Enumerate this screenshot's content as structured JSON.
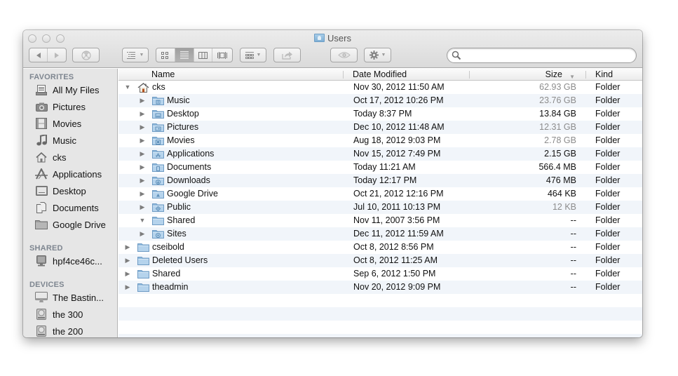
{
  "window": {
    "title": "Users",
    "title_icon": "users-folder-icon"
  },
  "toolbar": {
    "back_icon": "back-arrow-icon",
    "forward_icon": "forward-arrow-icon",
    "burn_icon": "burn-icon",
    "arrange_icon": "arrange-list-icon",
    "view_modes": [
      {
        "name": "icon-view",
        "glyph": "▫▫",
        "active": false
      },
      {
        "name": "list-view",
        "glyph": "≡",
        "active": true
      },
      {
        "name": "column-view",
        "glyph": "▥",
        "active": false
      },
      {
        "name": "cover-flow-view",
        "glyph": "|▬|",
        "active": false
      }
    ],
    "group_icon": "group-by-icon",
    "share_icon": "share-icon",
    "quicklook_icon": "eye-icon",
    "action_icon": "gear-icon",
    "search_placeholder": "",
    "search_value": ""
  },
  "sidebar": {
    "sections": [
      {
        "label": "FAVORITES",
        "items": [
          {
            "label": "All My Files",
            "icon": "all-files-icon"
          },
          {
            "label": "Pictures",
            "icon": "camera-icon"
          },
          {
            "label": "Movies",
            "icon": "film-icon"
          },
          {
            "label": "Music",
            "icon": "music-note-icon"
          },
          {
            "label": "cks",
            "icon": "home-icon"
          },
          {
            "label": "Applications",
            "icon": "applications-icon"
          },
          {
            "label": "Desktop",
            "icon": "desktop-icon"
          },
          {
            "label": "Documents",
            "icon": "documents-icon"
          },
          {
            "label": "Google Drive",
            "icon": "folder-icon"
          }
        ]
      },
      {
        "label": "SHARED",
        "items": [
          {
            "label": "hpf4ce46c...",
            "icon": "network-computer-icon"
          }
        ]
      },
      {
        "label": "DEVICES",
        "items": [
          {
            "label": "The Bastin...",
            "icon": "imac-icon"
          },
          {
            "label": "the 300",
            "icon": "hard-disk-icon"
          },
          {
            "label": "the 200",
            "icon": "hard-disk-icon"
          }
        ]
      }
    ]
  },
  "list": {
    "columns": {
      "name": "Name",
      "date": "Date Modified",
      "size": "Size",
      "kind": "Kind",
      "sort_column": "size",
      "sort_direction": "descending"
    },
    "rows": [
      {
        "name": "cks",
        "level": 0,
        "expanded": true,
        "icon": "home",
        "date": "Nov 30, 2012 11:50 AM",
        "size": "62.93 GB",
        "size_dim": true,
        "kind": "Folder"
      },
      {
        "name": "Music",
        "level": 1,
        "expanded": false,
        "icon": "music",
        "date": "Oct 17, 2012 10:26 PM",
        "size": "23.76 GB",
        "size_dim": true,
        "kind": "Folder"
      },
      {
        "name": "Desktop",
        "level": 1,
        "expanded": false,
        "icon": "desktop",
        "date": "Today 8:37 PM",
        "size": "13.84 GB",
        "size_dim": false,
        "kind": "Folder"
      },
      {
        "name": "Pictures",
        "level": 1,
        "expanded": false,
        "icon": "pictures",
        "date": "Dec 10, 2012 11:48 AM",
        "size": "12.31 GB",
        "size_dim": true,
        "kind": "Folder"
      },
      {
        "name": "Movies",
        "level": 1,
        "expanded": false,
        "icon": "movies",
        "date": "Aug 18, 2012 9:03 PM",
        "size": "2.78 GB",
        "size_dim": true,
        "kind": "Folder"
      },
      {
        "name": "Applications",
        "level": 1,
        "expanded": false,
        "icon": "applications",
        "date": "Nov 15, 2012 7:49 PM",
        "size": "2.15 GB",
        "size_dim": false,
        "kind": "Folder"
      },
      {
        "name": "Documents",
        "level": 1,
        "expanded": false,
        "icon": "documents",
        "date": "Today 11:21 AM",
        "size": "566.4 MB",
        "size_dim": false,
        "kind": "Folder"
      },
      {
        "name": "Downloads",
        "level": 1,
        "expanded": false,
        "icon": "downloads",
        "date": "Today 12:17 PM",
        "size": "476 MB",
        "size_dim": false,
        "kind": "Folder"
      },
      {
        "name": "Google Drive",
        "level": 1,
        "expanded": false,
        "icon": "google-drive",
        "date": "Oct 21, 2012 12:16 PM",
        "size": "464 KB",
        "size_dim": false,
        "kind": "Folder"
      },
      {
        "name": "Public",
        "level": 1,
        "expanded": false,
        "icon": "public",
        "date": "Jul 10, 2011 10:13 PM",
        "size": "12 KB",
        "size_dim": true,
        "kind": "Folder"
      },
      {
        "name": "Shared",
        "level": 1,
        "expanded": true,
        "icon": "plain",
        "date": "Nov 11, 2007 3:56 PM",
        "size": "--",
        "size_dim": false,
        "kind": "Folder"
      },
      {
        "name": "Sites",
        "level": 1,
        "expanded": false,
        "icon": "sites",
        "date": "Dec 11, 2012 11:59 AM",
        "size": "--",
        "size_dim": false,
        "kind": "Folder"
      },
      {
        "name": "cseibold",
        "level": 0,
        "expanded": false,
        "icon": "plain",
        "date": "Oct 8, 2012 8:56 PM",
        "size": "--",
        "size_dim": false,
        "kind": "Folder"
      },
      {
        "name": "Deleted Users",
        "level": 0,
        "expanded": false,
        "icon": "plain",
        "date": "Oct 8, 2012 11:25 AM",
        "size": "--",
        "size_dim": false,
        "kind": "Folder"
      },
      {
        "name": "Shared",
        "level": 0,
        "expanded": false,
        "icon": "plain",
        "date": "Sep 6, 2012 1:50 PM",
        "size": "--",
        "size_dim": false,
        "kind": "Folder"
      },
      {
        "name": "theadmin",
        "level": 0,
        "expanded": false,
        "icon": "plain",
        "date": "Nov 20, 2012 9:09 PM",
        "size": "--",
        "size_dim": false,
        "kind": "Folder"
      }
    ]
  }
}
